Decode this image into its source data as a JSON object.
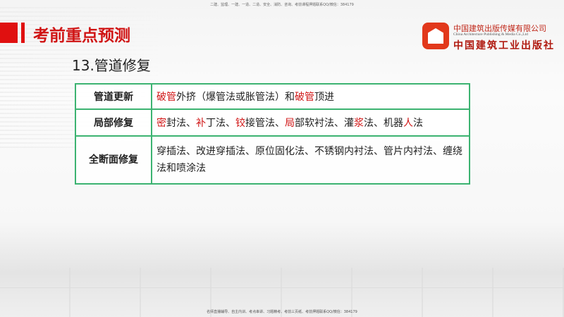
{
  "header": {
    "top_notice": "二建、监理、一建、一造、二造、安全、消防、咨询、考前课程押题联系QQ/微信：384179",
    "title": "考前重点预测",
    "subtitle": "13.管道修复"
  },
  "logo": {
    "cn_name": "中国建筑出版传媒有限公司",
    "en_name": "China Architecture Publishing & Media Co.,Ltd",
    "cn_press": "中国建筑工业出版社"
  },
  "table": {
    "rows": [
      {
        "label": "管道更新",
        "segments": [
          {
            "text": "破管",
            "red": true
          },
          {
            "text": "外挤（爆管法或胀管法）和",
            "red": false
          },
          {
            "text": "破管",
            "red": true
          },
          {
            "text": "顶进",
            "red": false
          }
        ]
      },
      {
        "label": "局部修复",
        "segments": [
          {
            "text": "密",
            "red": true
          },
          {
            "text": "封法、",
            "red": false
          },
          {
            "text": "补",
            "red": true
          },
          {
            "text": "丁法、",
            "red": false
          },
          {
            "text": "铰",
            "red": true
          },
          {
            "text": "接管法、",
            "red": false
          },
          {
            "text": "局",
            "red": true
          },
          {
            "text": "部软衬法、灌",
            "red": false
          },
          {
            "text": "浆",
            "red": true
          },
          {
            "text": "法、机器",
            "red": false
          },
          {
            "text": "人",
            "red": true
          },
          {
            "text": "法",
            "red": false
          }
        ]
      },
      {
        "label": "全断面修复",
        "segments": [
          {
            "text": "穿插法、改进穿插法、原位固化法、不锈钢内衬法、管片内衬法、缠绕法和喷涂法",
            "red": false
          }
        ]
      }
    ]
  },
  "footer": {
    "notice": "名师直播辅导、自主内训、考点串讲、习题精考、考前三页纸、考前押题联系QQ/微信：384179"
  },
  "colors": {
    "accent_red": "#d01414",
    "table_border": "#3cb371"
  }
}
